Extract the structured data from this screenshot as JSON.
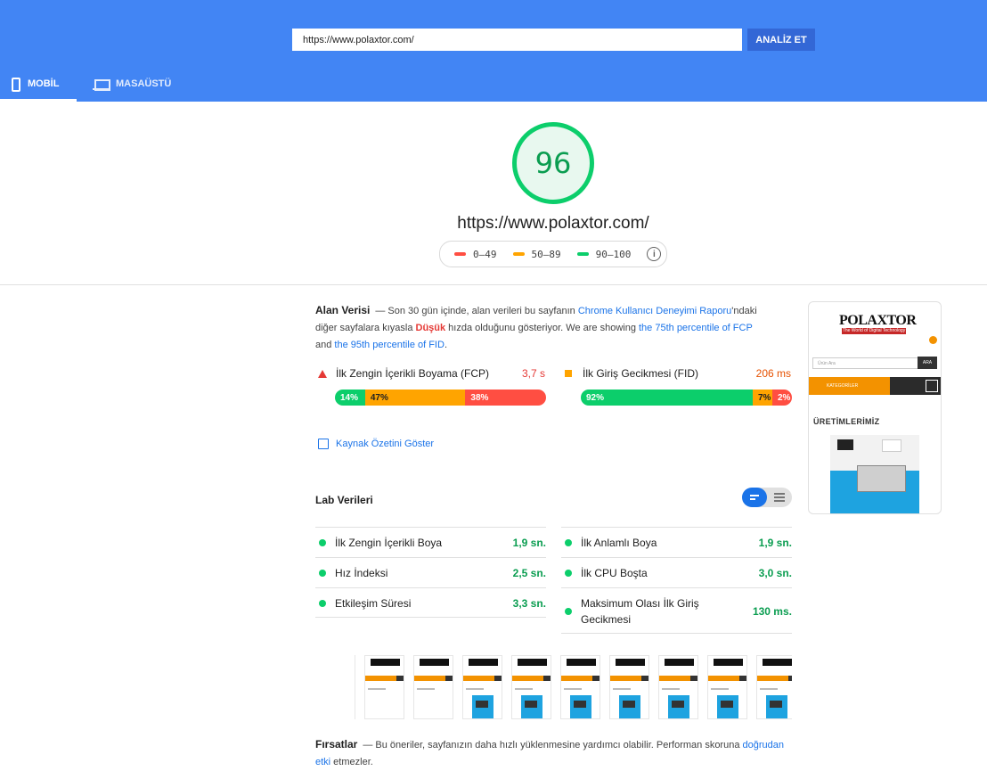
{
  "header": {
    "url_value": "https://www.polaxtor.com/",
    "analyze_label": "ANALİZ ET",
    "tabs": [
      {
        "label": "MOBİL",
        "icon": "phone-icon",
        "active": true
      },
      {
        "label": "MASAÜSTÜ",
        "icon": "laptop-icon",
        "active": false
      }
    ]
  },
  "score": {
    "value": "96",
    "url": "https://www.polaxtor.com/",
    "legend": [
      {
        "range": "0–49",
        "color": "#ff4e42"
      },
      {
        "range": "50–89",
        "color": "#ffa400"
      },
      {
        "range": "90–100",
        "color": "#0cce6b"
      }
    ],
    "info_icon": "i"
  },
  "field_data": {
    "title": "Alan Verisi",
    "desc_part1": "— Son 30 gün içinde, alan verileri bu sayfanın ",
    "desc_link1": "Chrome Kullanıcı Deneyimi Raporu",
    "desc_part2": "'ndaki diğer sayfalara kıyasla ",
    "desc_bad": "Düşük",
    "desc_part3": " hızda olduğunu gösteriyor. We are showing ",
    "desc_link2": "the 75th percentile of FCP",
    "desc_part4": " and ",
    "desc_link3": "the 95th percentile of FID",
    "desc_part5": ".",
    "metrics": [
      {
        "label": "İlk Zengin İçerikli Boyama (FCP)",
        "value": "3,7 s",
        "value_color": "#e53935",
        "distribution": [
          {
            "pct": "14%",
            "fraction": 0.14,
            "kind": "good"
          },
          {
            "pct": "47%",
            "fraction": 0.47,
            "kind": "average"
          },
          {
            "pct": "38%",
            "fraction": 0.38,
            "kind": "poor"
          }
        ]
      },
      {
        "label": "İlk Giriş Gecikmesi (FID)",
        "value": "206 ms",
        "value_color": "#e65100",
        "distribution": [
          {
            "pct": "92%",
            "fraction": 0.92,
            "kind": "good"
          },
          {
            "pct": "7%",
            "fraction": 0.07,
            "kind": "average"
          },
          {
            "pct": "2%",
            "fraction": 0.02,
            "kind": "poor"
          }
        ]
      }
    ],
    "origin_summary_label": "Kaynak Özetini Göster"
  },
  "lab_data": {
    "title": "Lab Verileri",
    "metrics_left": [
      {
        "label": "İlk Zengin İçerikli Boya",
        "value": "1,9 sn."
      },
      {
        "label": "Hız İndeksi",
        "value": "2,5 sn."
      },
      {
        "label": "Etkileşim Süresi",
        "value": "3,3 sn."
      }
    ],
    "metrics_right": [
      {
        "label": "İlk Anlamlı Boya",
        "value": "1,9 sn."
      },
      {
        "label": "İlk CPU Boşta",
        "value": "3,0 sn."
      },
      {
        "label": "Maksimum Olası İlk Giriş Gecikmesi",
        "value": "130 ms."
      }
    ]
  },
  "opportunities": {
    "title": "Fırsatlar",
    "desc_part1": "— Bu öneriler, sayfanızın daha hızlı yüklenmesine yardımcı olabilir. Performan skoruna ",
    "desc_link": "doğrudan etki",
    "desc_part2": " etmezler."
  },
  "screenshot": {
    "brand": "POLAXTOR",
    "brand_sub": "The World of Digital Technology",
    "search_placeholder": "Ürün Ara",
    "search_button": "ARA",
    "category_label": "KATEGORİLER",
    "heading": "ÜRETİMLERİMİZ"
  }
}
